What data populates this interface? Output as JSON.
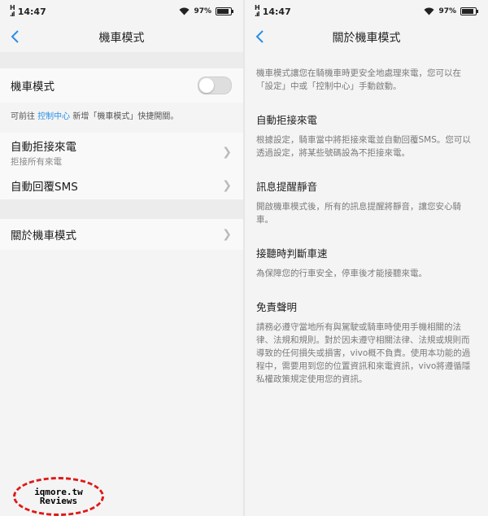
{
  "status": {
    "time": "14:47",
    "battery": "97%",
    "battery_level": 0.97
  },
  "left": {
    "title": "機車模式",
    "moto_mode_label": "機車模式",
    "moto_mode_on": false,
    "hint_prefix": "可前往 ",
    "hint_link": "控制中心",
    "hint_suffix": " 新增「機車模式」快捷開關。",
    "auto_reject_label": "自動拒接來電",
    "auto_reject_sub": "拒接所有來電",
    "auto_reply_label": "自動回覆SMS",
    "about_label": "關於機車模式"
  },
  "right": {
    "title": "關於機車模式",
    "intro": "機車模式讓您在騎機車時更安全地處理來電，您可以在「設定」中或「控制中心」手動啟動。",
    "sections": [
      {
        "heading": "自動拒接來電",
        "body": "根據設定，騎車當中將拒接來電並自動回覆SMS。您可以透過設定，將某些號碼設為不拒接來電。"
      },
      {
        "heading": "訊息提醒靜音",
        "body": "開啟機車模式後，所有的訊息提醒將靜音，讓您安心騎車。"
      },
      {
        "heading": "接聽時判斷車速",
        "body": "為保障您的行車安全，停車後才能接聽來電。"
      },
      {
        "heading": "免責聲明",
        "body": "請務必遵守當地所有與駕駛或騎車時使用手機相關的法律、法規和規則。對於因未遵守相關法律、法規或規則而導致的任何損失或損害，vivo概不負責。使用本功能的過程中，需要用到您的位置資訊和來電資訊，vivo將遵循隱私權政策規定使用您的資訊。"
      }
    ]
  },
  "watermark": {
    "line1": "iqmore.tw",
    "line2": "Reviews"
  },
  "colors": {
    "accent": "#2a8fe6",
    "watermark_ring": "#e01818"
  },
  "icons": {
    "back": "back-chevron-icon",
    "chevron": "chevron-right-icon",
    "wifi": "wifi-icon",
    "signal": "signal-icon",
    "battery": "battery-icon"
  }
}
